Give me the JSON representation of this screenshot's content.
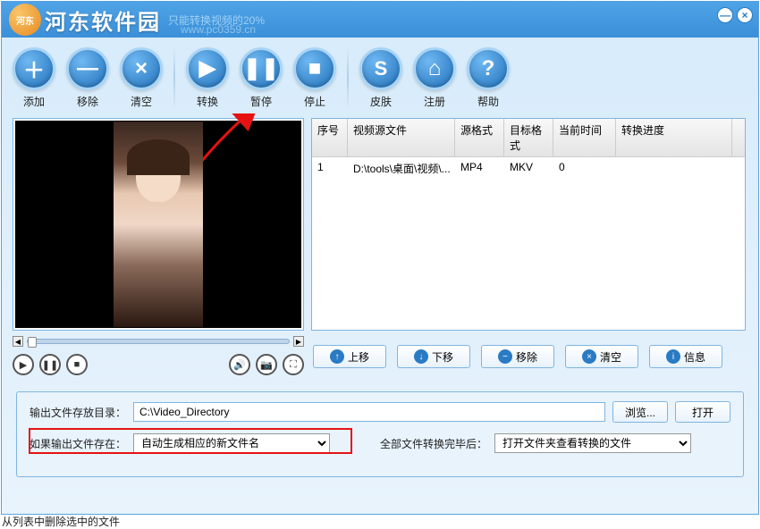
{
  "titlebar": {
    "site_name": "河东软件园",
    "subtitle": "只能转换视频的20%",
    "watermark": "www.pc0359.cn"
  },
  "toolbar": {
    "add": "添加",
    "remove": "移除",
    "clear": "清空",
    "convert": "转换",
    "pause": "暂停",
    "stop": "停止",
    "skin": "皮肤",
    "register": "注册",
    "help": "帮助"
  },
  "table": {
    "headers": {
      "idx": "序号",
      "source": "视频源文件",
      "src_fmt": "源格式",
      "tgt_fmt": "目标格式",
      "time": "当前时间",
      "progress": "转换进度"
    },
    "rows": [
      {
        "idx": "1",
        "source": "D:\\tools\\桌面\\视频\\...",
        "src_fmt": "MP4",
        "tgt_fmt": "MKV",
        "time": "0",
        "progress": ""
      }
    ]
  },
  "list_actions": {
    "up": "上移",
    "down": "下移",
    "remove": "移除",
    "clear": "清空",
    "info": "信息"
  },
  "output": {
    "dir_label": "输出文件存放目录：",
    "dir_value": "C:\\Video_Directory",
    "browse": "浏览...",
    "open": "打开",
    "exist_label": "如果输出文件存在：",
    "exist_value": "自动生成相应的新文件名",
    "after_label": "全部文件转换完毕后：",
    "after_value": "打开文件夹查看转换的文件"
  },
  "status": "从列表中删除选中的文件"
}
